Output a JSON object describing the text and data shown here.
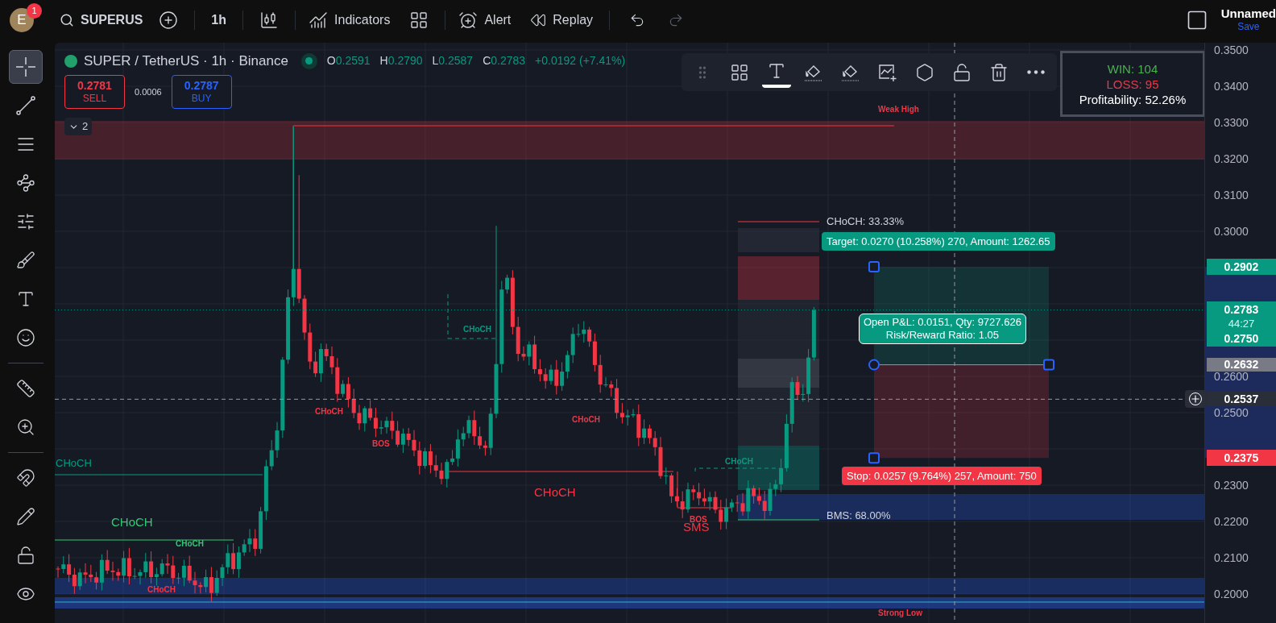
{
  "top_bar": {
    "avatar": "E",
    "notifications": "1",
    "symbol": "SUPERUS",
    "interval": "1h",
    "indicators": "Indicators",
    "alert": "Alert",
    "replay": "Replay",
    "layout_name": "Unnamed",
    "save": "Save"
  },
  "left_toolbar": [
    {
      "kind": "crosshair",
      "selected": true
    },
    {
      "kind": "trend-line",
      "selected": false
    },
    {
      "kind": "lines",
      "selected": false
    },
    {
      "kind": "pattern",
      "selected": false
    },
    {
      "kind": "projection",
      "selected": false
    },
    {
      "kind": "brush",
      "selected": false
    },
    {
      "kind": "text",
      "selected": false
    },
    {
      "kind": "emoji",
      "selected": false
    },
    {
      "kind": "ruler",
      "selected": false
    },
    {
      "kind": "zoom",
      "selected": false
    },
    {
      "kind": "magnet",
      "selected": false
    },
    {
      "kind": "pencil-lock",
      "selected": false
    },
    {
      "kind": "lock",
      "selected": false
    },
    {
      "kind": "eye",
      "selected": false
    }
  ],
  "legend": {
    "title": "SUPER / TetherUS · 1h · Binance",
    "values": [
      {
        "label": "O",
        "value": "0.2591"
      },
      {
        "label": "H",
        "value": "0.2790"
      },
      {
        "label": "L",
        "value": "0.2587"
      },
      {
        "label": "C",
        "value": "0.2783"
      }
    ],
    "change": "+0.0192 (+7.41%)"
  },
  "order": {
    "sell": {
      "price": "0.2781",
      "label": "SELL"
    },
    "spread": "0.0006",
    "buy": {
      "price": "0.2787",
      "label": "BUY"
    }
  },
  "indicator_toggle": {
    "count": "2"
  },
  "drawing_toolbar": [
    {
      "kind": "drag",
      "selected": false
    },
    {
      "kind": "add-grid",
      "selected": false
    },
    {
      "kind": "text",
      "selected": true
    },
    {
      "kind": "fill-teal",
      "selected": false
    },
    {
      "kind": "fill-red",
      "selected": false
    },
    {
      "kind": "chart-add",
      "selected": false
    },
    {
      "kind": "hexagon",
      "selected": false
    },
    {
      "kind": "unlock",
      "selected": false
    },
    {
      "kind": "trash",
      "selected": false
    },
    {
      "kind": "more",
      "selected": false
    }
  ],
  "stats": {
    "win": "WIN: 104",
    "loss": "LOSS: 95",
    "profitability": "Profitability: 52.26%"
  },
  "annotations": [
    {
      "text": "Weak High",
      "kind": "small",
      "color": "#f23645"
    },
    {
      "text": "CHoCH",
      "kind": "medium",
      "color": "#089981"
    },
    {
      "text": "CHoCH",
      "kind": "large",
      "color": "#2ecc71"
    },
    {
      "text": "CHoCH",
      "kind": "small",
      "color": "#2ecc71"
    },
    {
      "text": "CHoCH",
      "kind": "small",
      "color": "#f23645"
    },
    {
      "text": "CHoCH",
      "kind": "small",
      "color": "#f23645"
    },
    {
      "text": "BOS",
      "kind": "small",
      "color": "#f23645"
    },
    {
      "text": "CHoCH",
      "kind": "small",
      "color": "#089981"
    },
    {
      "text": "CHoCH",
      "kind": "small",
      "color": "#f23645"
    },
    {
      "text": "CHoCH",
      "kind": "large",
      "color": "#f23645"
    },
    {
      "text": "BOS",
      "kind": "small",
      "color": "#f23645"
    },
    {
      "text": "SMS",
      "kind": "large",
      "color": "#f23645"
    },
    {
      "text": "CHoCH",
      "kind": "small",
      "color": "#089981"
    },
    {
      "text": "CHoCH: 33.33%",
      "kind": "medium",
      "color": "#d1d4dc"
    },
    {
      "text": "BMS: 68.00%",
      "kind": "medium",
      "color": "#d1d4dc"
    },
    {
      "text": "Strong Low",
      "kind": "small",
      "color": "#f23645"
    }
  ],
  "position_tool": {
    "target": "Target: 0.0270 (10.258%) 270, Amount: 1262.65",
    "pnl": [
      "Open P&L: 0.0151, Qty: 9727.626",
      "Risk/Reward Ratio: 1.05"
    ],
    "stop": "Stop: 0.0257 (9.764%) 257, Amount: 750"
  },
  "price_axis": {
    "ticks": [
      "0.3500",
      "0.3400",
      "0.3300",
      "0.3200",
      "0.3100",
      "0.3000",
      "0.2600",
      "0.2500",
      "0.2300",
      "0.2200",
      "0.2100",
      "0.2000"
    ],
    "labels": [
      {
        "kind": "target",
        "text": "0.2902"
      },
      {
        "kind": "last",
        "text": "0.2783",
        "countdown": "44:27",
        "secondary": "0.2750"
      },
      {
        "kind": "entry",
        "text": "0.2632"
      },
      {
        "kind": "crosshair",
        "text": "0.2537"
      },
      {
        "kind": "stop",
        "text": "0.2375"
      }
    ]
  }
}
